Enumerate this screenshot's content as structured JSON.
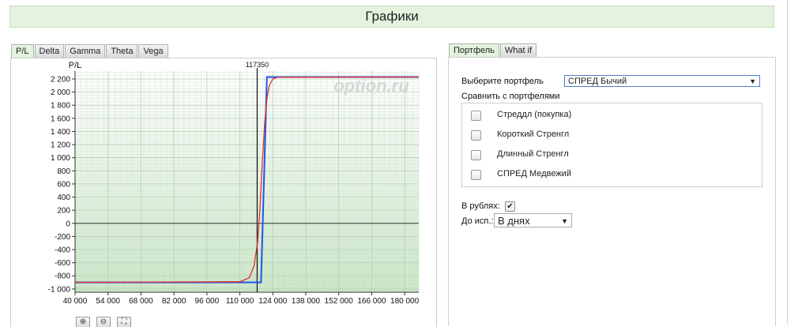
{
  "page_title": "Графики",
  "left_tabs": [
    "P/L",
    "Delta",
    "Gamma",
    "Theta",
    "Vega"
  ],
  "right_tabs": [
    "Портфель",
    "What if"
  ],
  "watermark": "option.ru",
  "colors": {
    "payoff_expiry": "#2255e8",
    "payoff_now": "#e03030",
    "plot_bg_bottom": "#c6e4c4"
  },
  "chart_data": {
    "type": "line",
    "ylabel": "P/L",
    "xlabel": "",
    "xlim": [
      40000,
      186000
    ],
    "ylim": [
      -1050,
      2320
    ],
    "xticks": [
      40000,
      54000,
      68000,
      82000,
      96000,
      110000,
      124000,
      138000,
      152000,
      166000,
      180000
    ],
    "xtick_labels": [
      "40 000",
      "54 000",
      "68 000",
      "82 000",
      "96 000",
      "110 000",
      "124 000",
      "138 000",
      "152 000",
      "166 000",
      "180 000"
    ],
    "yticks": [
      -1000,
      -800,
      -600,
      -400,
      -200,
      0,
      200,
      400,
      600,
      800,
      1000,
      1200,
      1400,
      1600,
      1800,
      2000,
      2200
    ],
    "ytick_labels": [
      "-1 000",
      "-800",
      "-600",
      "-400",
      "-200",
      "0",
      "200",
      "400",
      "600",
      "800",
      "1 000",
      "1 200",
      "1 400",
      "1 600",
      "1 800",
      "2 000",
      "2 200"
    ],
    "vline": {
      "x": 117350,
      "label": "117350"
    },
    "grid": true,
    "series": [
      {
        "values_x": [
          40000,
          119000,
          121500,
          186000
        ],
        "values_y": [
          -900,
          -900,
          2230,
          2230
        ]
      },
      {
        "values_x": [
          40000,
          110000,
          114000,
          116000,
          117500,
          118500,
          119500,
          120500,
          121500,
          122500,
          124000,
          126000,
          186000
        ],
        "values_y": [
          -900,
          -890,
          -830,
          -650,
          -300,
          200,
          900,
          1500,
          1900,
          2100,
          2200,
          2225,
          2230
        ]
      }
    ]
  },
  "form": {
    "select_portfolio_label": "Выберите портфель",
    "selected_portfolio": "СПРЕД Бычий",
    "compare_label": "Сравнить с портфелями",
    "compare_items": [
      "Стреддл (покупка)",
      "Короткий Стренгл",
      "Длинный Стренгл",
      "СПРЕД Медвежий"
    ],
    "in_rubles_label": "В рублях:",
    "to_expiry_label": "До исп.:",
    "to_expiry_value": "В днях"
  }
}
